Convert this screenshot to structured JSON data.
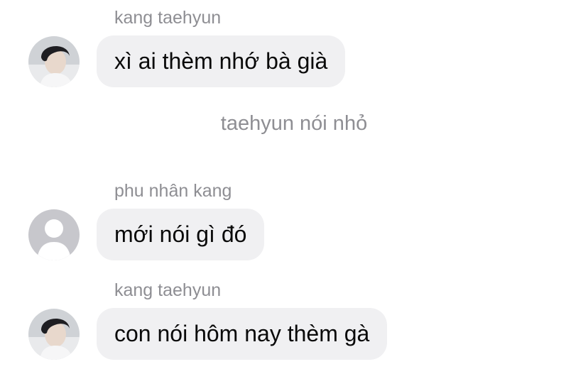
{
  "messages": [
    {
      "sender": "kang taehyun",
      "text": "xì ai thèm nhớ bà già",
      "avatar_icon": "user-photo-avatar"
    },
    {
      "sender": "phu nhân kang",
      "text": "mới nói gì đó",
      "avatar_icon": "default-person-avatar"
    },
    {
      "sender": "kang taehyun",
      "text": "con nói hôm nay thèm gà",
      "avatar_icon": "user-photo-avatar"
    }
  ],
  "system_note": "taehyun nói nhỏ",
  "colors": {
    "background": "#ffffff",
    "bubble": "#f0f0f2",
    "secondary_text": "#8e8e93",
    "primary_text": "#0a0a0a",
    "default_avatar": "#c7c7cc"
  }
}
